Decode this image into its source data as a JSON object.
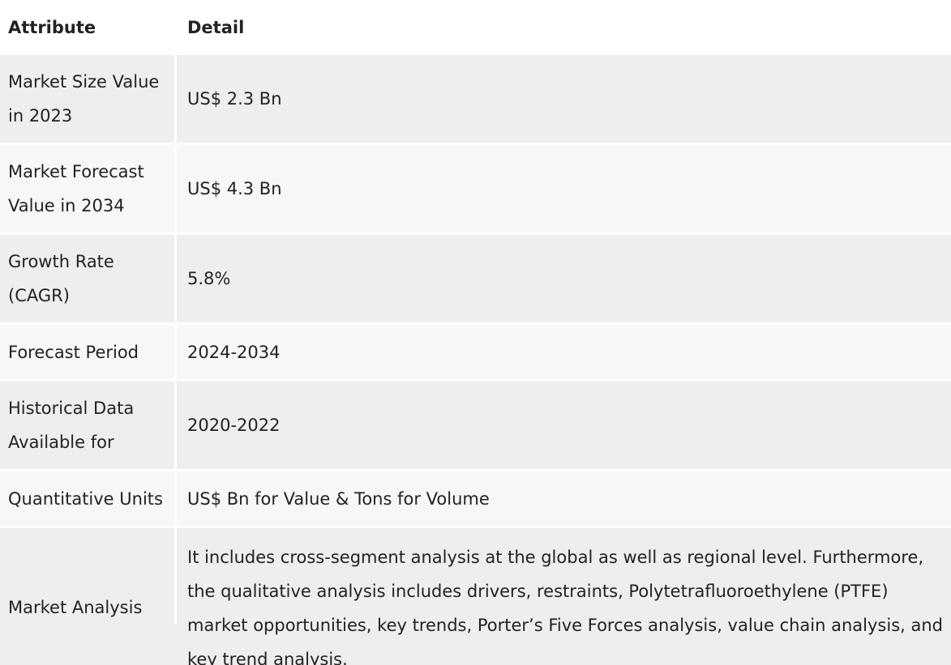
{
  "table": {
    "headers": {
      "attribute": "Attribute",
      "detail": "Detail"
    },
    "rows": [
      {
        "attribute": "Market Size Value in 2023",
        "detail": "US$ 2.3 Bn"
      },
      {
        "attribute": "Market Forecast Value in 2034",
        "detail": "US$ 4.3 Bn"
      },
      {
        "attribute": "Growth Rate (CAGR)",
        "detail": "5.8%"
      },
      {
        "attribute": "Forecast Period",
        "detail": "2024-2034"
      },
      {
        "attribute": "Historical Data Available for",
        "detail": "2020-2022"
      },
      {
        "attribute": "Quantitative Units",
        "detail": "US$ Bn for Value & Tons for Volume"
      },
      {
        "attribute": "Market Analysis",
        "detail": "It includes cross-segment analysis at the global as well as regional level. Furthermore, the qualitative analysis includes drivers, restraints, Polytetrafluoroethylene (PTFE) market opportunities, key trends, Porter’s Five Forces analysis, value chain analysis, and key trend analysis."
      }
    ]
  }
}
